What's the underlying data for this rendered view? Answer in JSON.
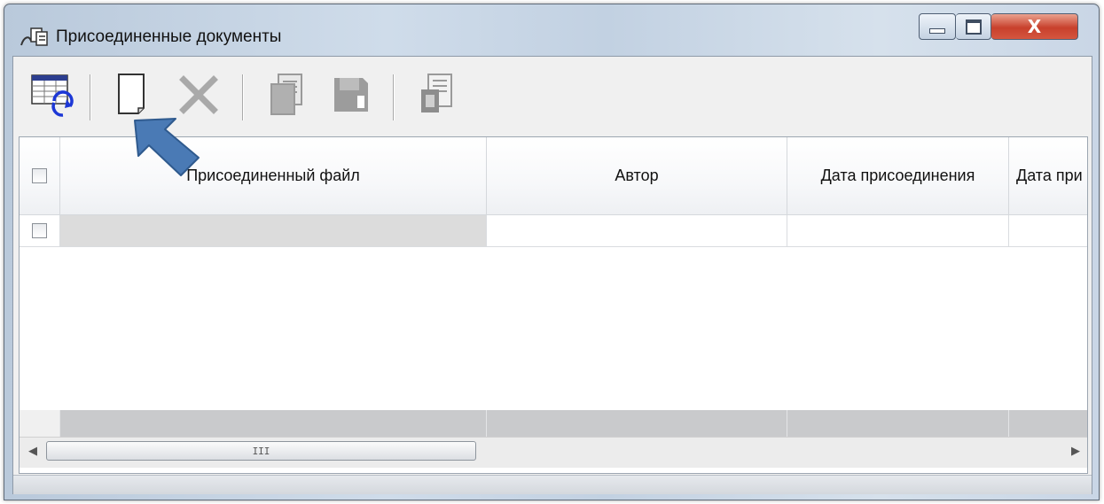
{
  "window": {
    "title": "Присоединенные документы",
    "close_glyph": "X"
  },
  "toolbar": {
    "buttons": [
      {
        "icon": "refresh-grid-icon",
        "enabled": true
      },
      {
        "icon": "new-document-icon",
        "enabled": true
      },
      {
        "icon": "delete-icon",
        "enabled": false
      },
      {
        "icon": "copy-document-icon",
        "enabled": false
      },
      {
        "icon": "save-icon",
        "enabled": false
      },
      {
        "icon": "attach-document-icon",
        "enabled": false
      }
    ]
  },
  "grid": {
    "columns": [
      "Присоединенный файл",
      "Автор",
      "Дата присоединения",
      "Дата при"
    ],
    "rows": [
      {
        "file": "",
        "author": "",
        "date_attached": "",
        "date_other": ""
      }
    ],
    "scroll_thumb_glyph": "III"
  },
  "annotation": {
    "pointer_icon": "blue-arrow-icon",
    "pointer_color": "#4a7ab5"
  },
  "colors": {
    "close_button": "#c8402c",
    "pointer": "#4a7ab5",
    "footer_row": "#c9cacc"
  }
}
